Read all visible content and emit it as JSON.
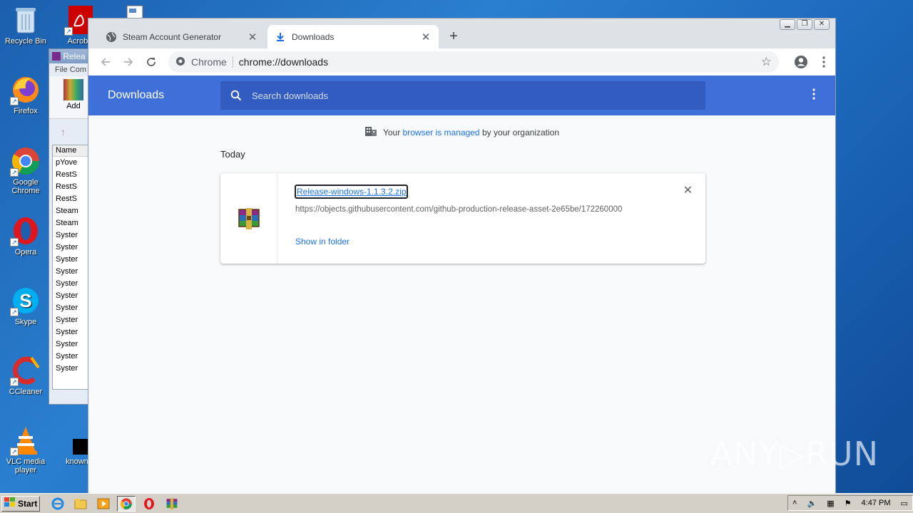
{
  "desktop": {
    "icons": [
      {
        "label": "Recycle Bin"
      },
      {
        "label": "Acroba"
      },
      {
        "label": "Firefox"
      },
      {
        "label": "Google Chrome"
      },
      {
        "label": "Opera"
      },
      {
        "label": "Skype"
      },
      {
        "label": "CCleaner"
      },
      {
        "label": "VLC media player"
      },
      {
        "label": "knownyi"
      }
    ]
  },
  "bg_window": {
    "title": "Relea",
    "menu": "File  Com",
    "add_label": "Add",
    "column": "Name",
    "rows": [
      "pYove",
      "RestS",
      "RestS",
      "RestS",
      "Steam",
      "Steam",
      "Syster",
      "Syster",
      "Syster",
      "Syster",
      "Syster",
      "Syster",
      "Syster",
      "Syster",
      "Syster",
      "Syster",
      "Syster",
      "Syster"
    ]
  },
  "browser": {
    "tabs": [
      {
        "title": "Steam Account Generator",
        "active": false
      },
      {
        "title": "Downloads",
        "active": true
      }
    ],
    "new_tab": "+",
    "omnibox": {
      "site": "Chrome",
      "url": "chrome://downloads"
    },
    "page": {
      "header_title": "Downloads",
      "search_placeholder": "Search downloads",
      "managed_prefix": "Your",
      "managed_link": "browser is managed",
      "managed_suffix": "by your organization",
      "section": "Today",
      "download": {
        "filename": "Release-windows-1.1.3.2.zip",
        "source": "https://objects.githubusercontent.com/github-production-release-asset-2e65be/172260000",
        "action": "Show in folder"
      }
    }
  },
  "watermark": "ANY▷RUN",
  "taskbar": {
    "start": "Start",
    "clock": "4:47 PM"
  }
}
